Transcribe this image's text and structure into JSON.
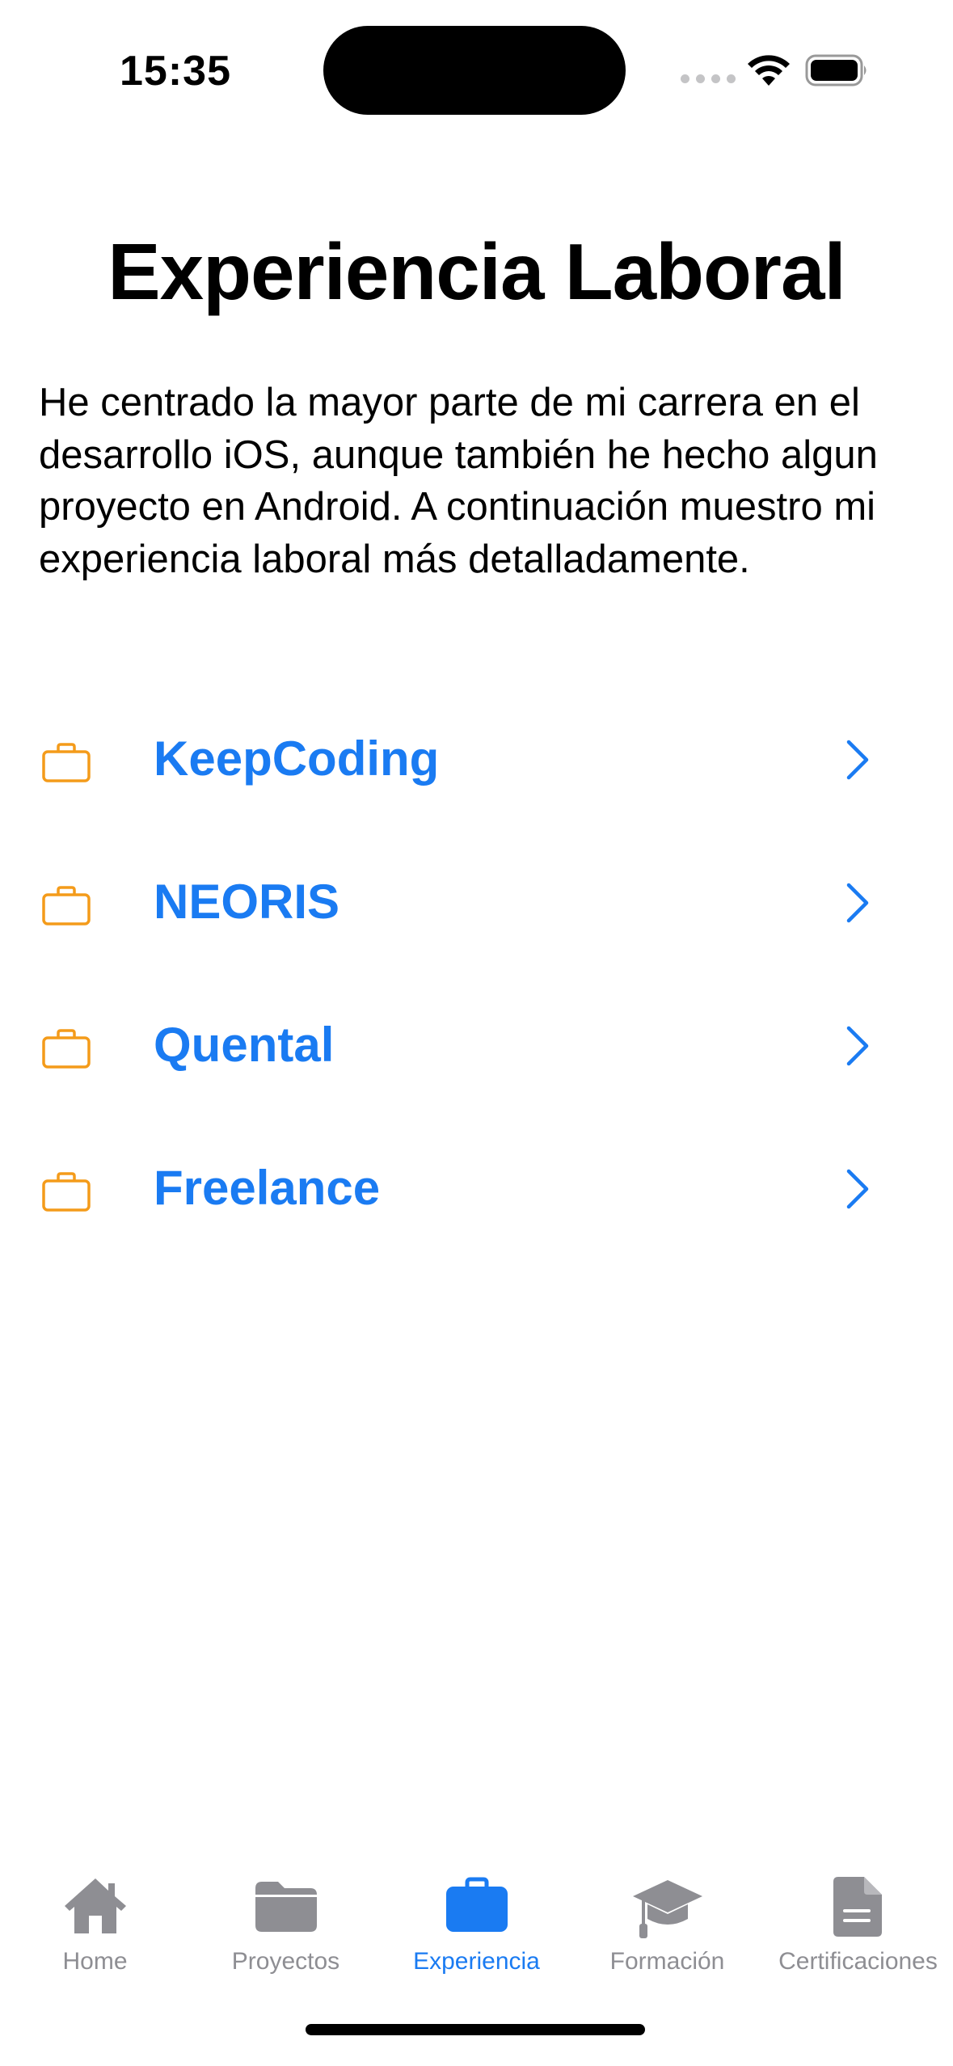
{
  "status_bar": {
    "time": "15:35"
  },
  "page": {
    "title": "Experiencia Laboral",
    "intro": "He centrado la mayor parte de mi carrera en el desarrollo iOS, aunque también he hecho algun proyecto en Android. A continuación muestro mi experiencia laboral más detalladamente."
  },
  "experience": {
    "items": [
      {
        "label": "KeepCoding",
        "icon": "briefcase-icon"
      },
      {
        "label": "NEORIS",
        "icon": "briefcase-icon"
      },
      {
        "label": "Quental",
        "icon": "briefcase-icon"
      },
      {
        "label": "Freelance",
        "icon": "briefcase-icon"
      }
    ]
  },
  "tab_bar": {
    "tabs": [
      {
        "label": "Home",
        "icon": "house-icon"
      },
      {
        "label": "Proyectos",
        "icon": "folder-icon"
      },
      {
        "label": "Experiencia",
        "icon": "briefcase-icon",
        "active": true
      },
      {
        "label": "Formación",
        "icon": "graduation-cap-icon"
      },
      {
        "label": "Certificaciones",
        "icon": "document-icon"
      }
    ]
  },
  "colors": {
    "accent": "#1a7bf2",
    "icon_orange": "#f49b1a",
    "tab_inactive": "#8e8e93"
  }
}
